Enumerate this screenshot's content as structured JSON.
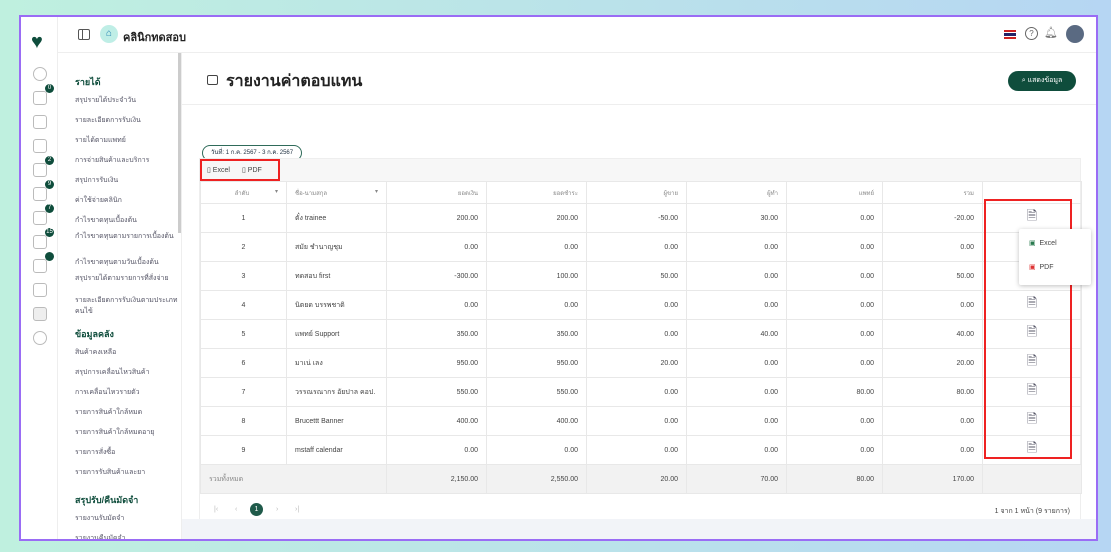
{
  "app": {
    "clinic_name": "คลินิกทดสอบ"
  },
  "rail_badges": [
    "0",
    "2",
    "9",
    "7",
    "15",
    ""
  ],
  "submenu": {
    "sections": [
      {
        "title": "รายได้",
        "items": [
          "สรุปรายได้ประจำวัน",
          "รายละเอียดการรับเงิน",
          "รายได้ตามแพทย์",
          "การจ่ายสินค้าและบริการ",
          "สรุปการรับเงิน",
          "ค่าใช้จ่ายคลินิก",
          "กำไรขาดทุนเบื้องต้น",
          "กำไรขาดทุนตามรายการเบื้องต้น",
          "กำไรขาดทุนตามวันเบื้องต้น",
          "สรุปรายได้ตามรายการที่สั่งจ่าย",
          "รายละเอียดการรับเงินตามประเภทคนไข้"
        ]
      },
      {
        "title": "ข้อมูลคลัง",
        "items": [
          "สินค้าคงเหลือ",
          "สรุปการเคลื่อนไหวสินค้า",
          "การเคลื่อนไหวรายตัว",
          "รายการสินค้าใกล้หมด",
          "รายการสินค้าใกล้หมดอายุ",
          "รายการสั่งซื้อ",
          "รายการรับสินค้าและยา"
        ]
      },
      {
        "title": "สรุปรับ/คืนมัดจำ",
        "items": [
          "รายงานรับมัดจำ",
          "รายงานคืนมัดจำ"
        ]
      }
    ]
  },
  "page": {
    "title": "รายงานค่าตอบแทน",
    "show_button": "แสดงข้อมูล",
    "date_chip": "วันที่: 1 ก.ค. 2567 - 3 ก.ค. 2567",
    "export_excel": "Excel",
    "export_pdf": "PDF"
  },
  "table": {
    "columns": [
      "ลำดับ",
      "ชื่อ-นามสกุล",
      "ยอดเงิน",
      "ยอดชำระ",
      "ผู้ขาย",
      "ผู้ทำ",
      "แพทย์",
      "รวม"
    ],
    "rows": [
      [
        "1",
        "ตั๋ง trainee",
        "200.00",
        "200.00",
        "-50.00",
        "30.00",
        "0.00",
        "-20.00"
      ],
      [
        "2",
        "สมัย ชำนาญชุม",
        "0.00",
        "0.00",
        "0.00",
        "0.00",
        "0.00",
        "0.00"
      ],
      [
        "3",
        "ทดสอบ first",
        "-300.00",
        "100.00",
        "50.00",
        "0.00",
        "0.00",
        "50.00"
      ],
      [
        "4",
        "นิตยด บรรพชาติ",
        "0.00",
        "0.00",
        "0.00",
        "0.00",
        "0.00",
        "0.00"
      ],
      [
        "5",
        "แพทย์ Support",
        "350.00",
        "350.00",
        "0.00",
        "40.00",
        "0.00",
        "40.00"
      ],
      [
        "6",
        "มาเน่ เลง",
        "950.00",
        "950.00",
        "20.00",
        "0.00",
        "0.00",
        "20.00"
      ],
      [
        "7",
        "วรรณรณากร อัยปาล คอป.",
        "550.00",
        "550.00",
        "0.00",
        "0.00",
        "80.00",
        "80.00"
      ],
      [
        "8",
        "Brucettt Banner",
        "400.00",
        "400.00",
        "0.00",
        "0.00",
        "0.00",
        "0.00"
      ],
      [
        "9",
        "mstaff calendar",
        "0.00",
        "0.00",
        "0.00",
        "0.00",
        "0.00",
        "0.00"
      ]
    ],
    "total_label": "รวมทั้งหมด",
    "totals": [
      "2,150.00",
      "2,550.00",
      "20.00",
      "70.00",
      "80.00",
      "170.00"
    ],
    "current_page": "1",
    "page_info": "1 จาก 1 หน้า (9 รายการ)"
  },
  "row_menu": {
    "excel": "Excel",
    "pdf": "PDF"
  }
}
